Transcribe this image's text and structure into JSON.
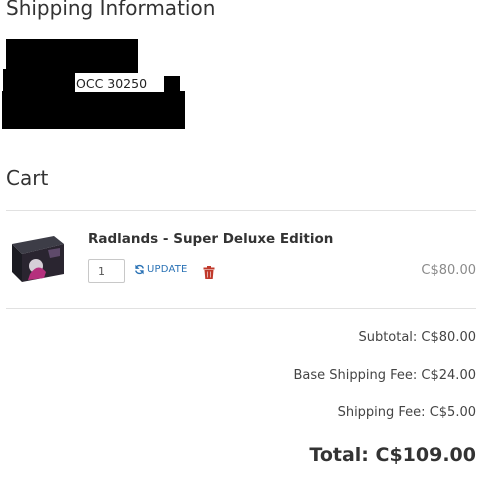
{
  "shipping": {
    "title": "Shipping Information",
    "visible_fragment": "OCC 30250"
  },
  "cart": {
    "title": "Cart",
    "items": [
      {
        "name": "Radlands - Super Deluxe Edition",
        "quantity": "1",
        "update_label": "UPDATE",
        "price": "C$80.00"
      }
    ]
  },
  "summary": {
    "subtotal": "Subtotal: C$80.00",
    "base_shipping": "Base Shipping Fee: C$24.00",
    "shipping_fee": "Shipping Fee: C$5.00",
    "total": "Total: C$109.00"
  },
  "colors": {
    "link": "#2a72b5",
    "delete": "#c0392b",
    "redaction": "#000000"
  },
  "icons": [
    "refresh-icon",
    "trash-icon"
  ]
}
